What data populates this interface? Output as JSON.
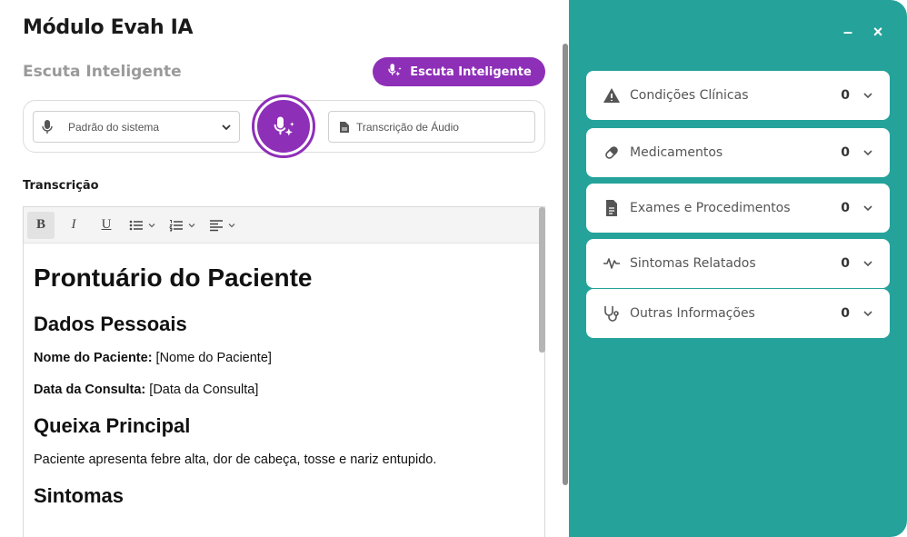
{
  "app": {
    "title": "Módulo Evah IA",
    "subtitle": "Escuta Inteligente"
  },
  "listen_button": {
    "label": "Escuta Inteligente"
  },
  "audio_select": {
    "value": "Padrão do sistema"
  },
  "transcript_field": {
    "label": "Transcrição de Áudio"
  },
  "transcription": {
    "section_label": "Transcrição"
  },
  "toolbar": {
    "bold": "B",
    "italic": "I",
    "underline": "U"
  },
  "document": {
    "title": "Prontuário do Paciente",
    "h_personal": "Dados Pessoais",
    "name_label": "Nome do Paciente:",
    "name_value": " [Nome do Paciente]",
    "date_label": "Data da Consulta:",
    "date_value": " [Data da Consulta]",
    "h_complaint": "Queixa Principal",
    "complaint_text": "Paciente apresenta febre alta, dor de cabeça, tosse e nariz entupido.",
    "h_symptoms": "Sintomas"
  },
  "window": {
    "minimize": "–",
    "close": "×"
  },
  "cards": [
    {
      "label": "Condições Clínicas",
      "count": "0",
      "icon": "warning-icon"
    },
    {
      "label": "Medicamentos",
      "count": "0",
      "icon": "pill-icon"
    },
    {
      "label": "Exames e Procedimentos",
      "count": "0",
      "icon": "document-icon"
    },
    {
      "label": "Sintomas Relatados",
      "count": "0",
      "icon": "pulse-icon"
    },
    {
      "label": "Outras Informações",
      "count": "0",
      "icon": "stethoscope-icon"
    }
  ],
  "colors": {
    "purple": "#8e2fb8",
    "teal": "#25a39b"
  }
}
